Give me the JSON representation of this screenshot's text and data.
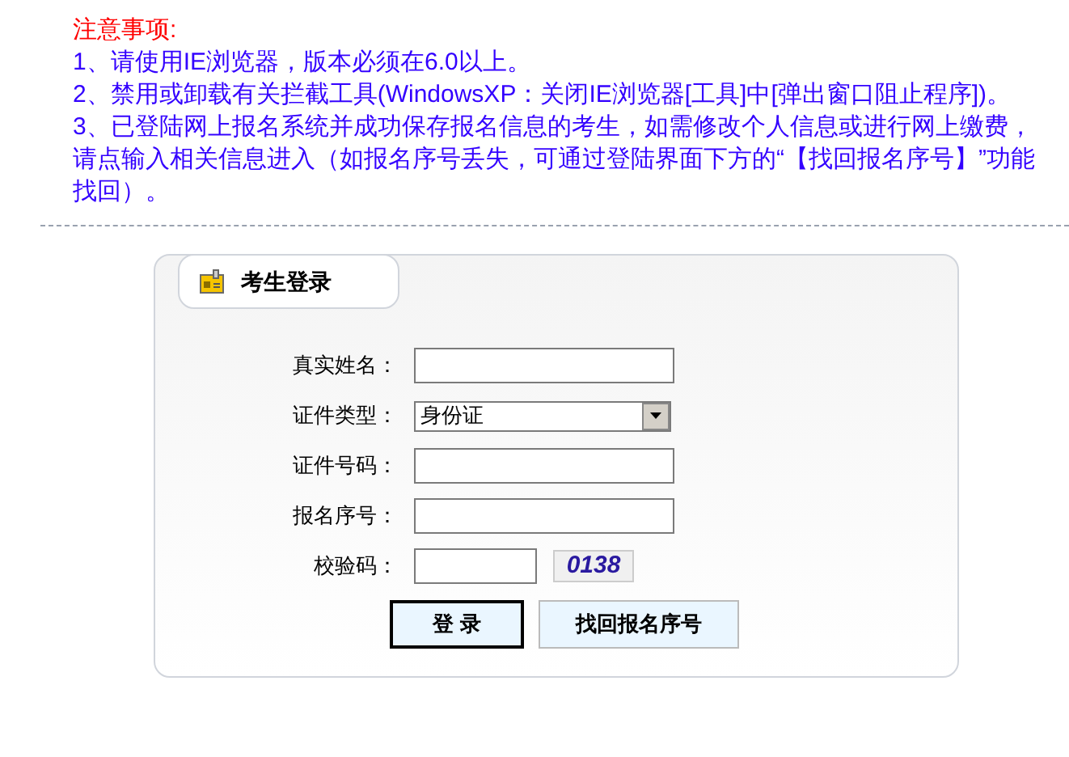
{
  "notice": {
    "title": "注意事项:",
    "items": [
      "1、请使用IE浏览器，版本必须在6.0以上。",
      "2、禁用或卸载有关拦截工具(WindowsXP：关闭IE浏览器[工具]中[弹出窗口阻止程序])。",
      "3、已登陆网上报名系统并成功保存报名信息的考生，如需修改个人信息或进行网上缴费，请点输入相关信息进入（如报名序号丢失，可通过登陆界面下方的“【找回报名序号】”功能找回）。"
    ]
  },
  "login_panel": {
    "title": "考生登录",
    "fields": [
      {
        "kind": "text",
        "label": "真实姓名："
      },
      {
        "kind": "select",
        "label": "证件类型：",
        "value": "身份证"
      },
      {
        "kind": "text",
        "label": "证件号码："
      },
      {
        "kind": "text",
        "label": "报名序号："
      },
      {
        "kind": "captcha",
        "label": "校验码：",
        "captcha": "0138"
      }
    ],
    "buttons": [
      {
        "label": "登 录",
        "kind": "primary"
      },
      {
        "label": "找回报名序号",
        "kind": "secondary"
      }
    ]
  }
}
